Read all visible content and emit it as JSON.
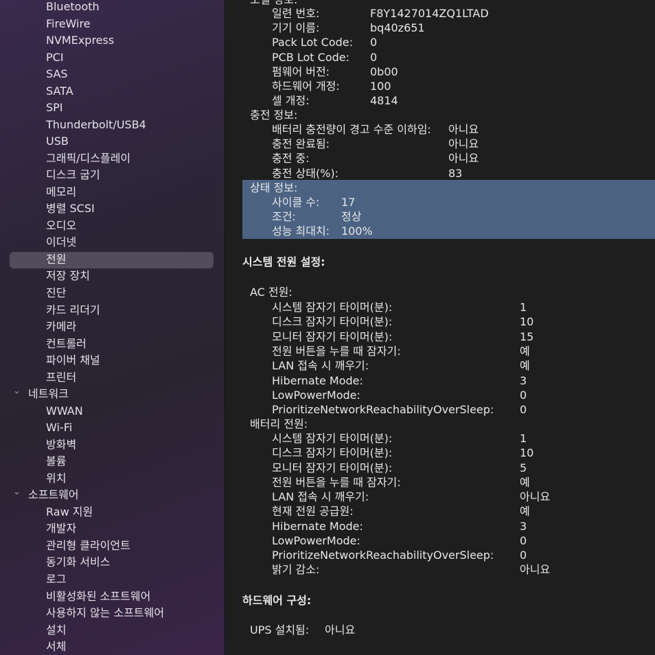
{
  "sidebar": {
    "items": [
      "Bluetooth",
      "FireWire",
      "NVMExpress",
      "PCI",
      "SAS",
      "SATA",
      "SPI",
      "Thunderbolt/USB4",
      "USB",
      "그래픽/디스플레이",
      "디스크 굽기",
      "메모리",
      "병렬 SCSI",
      "오디오",
      "이더넷",
      "전원",
      "저장 장치",
      "진단",
      "카드 리더기",
      "카메라",
      "컨트롤러",
      "파이버 채널",
      "프린터"
    ],
    "network": {
      "label": "네트워크",
      "items": [
        "WWAN",
        "Wi-Fi",
        "방화벽",
        "볼륨",
        "위치"
      ]
    },
    "software": {
      "label": "소프트웨어",
      "items": [
        "Raw 지원",
        "개발자",
        "관리형 클라이언트",
        "동기화 서비스",
        "로그",
        "비활성화된 소프트웨어",
        "사용하지 않는 소프트웨어",
        "설치",
        "서체"
      ]
    },
    "selected": "전원"
  },
  "model": {
    "label": "모델 정보:",
    "rows": [
      [
        "일련 번호:",
        "F8Y1427014ZQ1LTAD"
      ],
      [
        "기기 이름:",
        "bq40z651"
      ],
      [
        "Pack Lot Code:",
        "0"
      ],
      [
        "PCB Lot Code:",
        "0"
      ],
      [
        "펌웨어 버전:",
        "0b00"
      ],
      [
        "하드웨어 개정:",
        "100"
      ],
      [
        "셀 개정:",
        "4814"
      ]
    ]
  },
  "charge": {
    "label": "충전 정보:",
    "rows": [
      [
        "배터리 충전량이 경고 수준 이하임:",
        "아니요"
      ],
      [
        "충전 완료됨:",
        "아니요"
      ],
      [
        "충전 중:",
        "아니요"
      ],
      [
        "충전 상태(%):",
        "83"
      ]
    ]
  },
  "health": {
    "label": "상태 정보:",
    "rows": [
      [
        "사이클 수:",
        "17"
      ],
      [
        "조건:",
        "정상"
      ],
      [
        "성능 최대치:",
        "100%"
      ]
    ]
  },
  "power_settings": {
    "heading": "시스템 전원 설정:",
    "ac": {
      "label": "AC 전원:",
      "rows": [
        [
          "시스템 잠자기 타이머(분):",
          "1"
        ],
        [
          "디스크 잠자기 타이머(분):",
          "10"
        ],
        [
          "모니터 잠자기 타이머(분):",
          "15"
        ],
        [
          "전원 버튼을 누를 때 잠자기:",
          "예"
        ],
        [
          "LAN 접속 시 깨우기:",
          "예"
        ],
        [
          "Hibernate Mode:",
          "3"
        ],
        [
          "LowPowerMode:",
          "0"
        ],
        [
          "PrioritizeNetworkReachabilityOverSleep:",
          "0"
        ]
      ]
    },
    "battery": {
      "label": "배터리 전원:",
      "rows": [
        [
          "시스템 잠자기 타이머(분):",
          "1"
        ],
        [
          "디스크 잠자기 타이머(분):",
          "10"
        ],
        [
          "모니터 잠자기 타이머(분):",
          "5"
        ],
        [
          "전원 버튼을 누를 때 잠자기:",
          "예"
        ],
        [
          "LAN 접속 시 깨우기:",
          "아니요"
        ],
        [
          "현재 전원 공급원:",
          "예"
        ],
        [
          "Hibernate Mode:",
          "3"
        ],
        [
          "LowPowerMode:",
          "0"
        ],
        [
          "PrioritizeNetworkReachabilityOverSleep:",
          "0"
        ],
        [
          "밝기 감소:",
          "아니요"
        ]
      ]
    }
  },
  "hardware": {
    "heading": "하드웨어 구성:",
    "ups_label": "UPS 설치됨:",
    "ups_value": "아니요"
  },
  "colors": {
    "selection": "#4b6283",
    "sidebar_selected": "#5a5562",
    "background": "#1e1e1e"
  }
}
